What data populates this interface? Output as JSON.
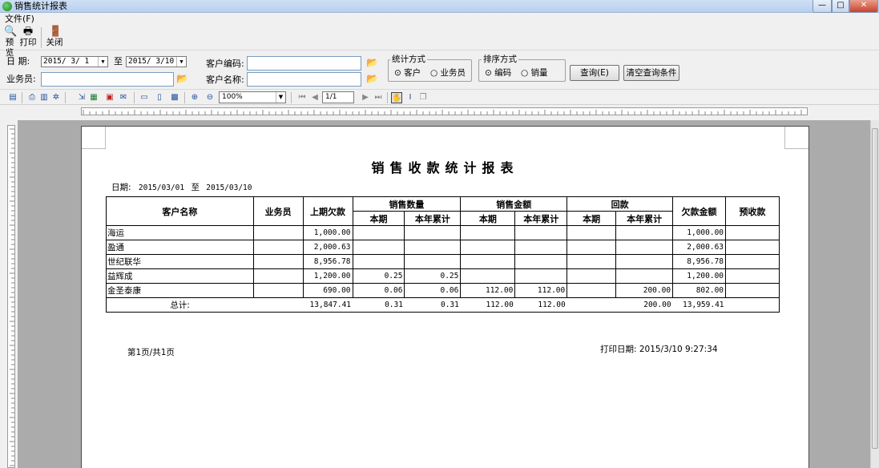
{
  "window": {
    "title": "销售统计报表",
    "controls": [
      "—",
      "□",
      "✕"
    ]
  },
  "menu": {
    "file": "文件(F)"
  },
  "toolbar": {
    "preview": "预览",
    "print": "打印",
    "close": "关闭"
  },
  "filters": {
    "date_label": "日 期:",
    "date_from": "2015/ 3/ 1",
    "to_label": "至",
    "date_to": "2015/ 3/10",
    "salesman_label": "业务员:",
    "salesman_value": "",
    "customer_code_label": "客户编码:",
    "customer_code_value": "",
    "customer_name_label": "客户名称:",
    "customer_name_value": "",
    "stat_group_title": "统计方式",
    "stat_options": [
      "客户",
      "业务员"
    ],
    "stat_selected": "客户",
    "sort_group_title": "排序方式",
    "sort_options": [
      "编码",
      "销量"
    ],
    "sort_selected": "编码",
    "query_button": "查询(E)",
    "clear_button": "清空查询条件"
  },
  "preview_toolbar": {
    "zoom": "100%",
    "page": "1/1"
  },
  "report": {
    "title": "销售收款统计报表",
    "date_line_label": "日期:",
    "date_from": "2015/03/01",
    "date_to_label": "至",
    "date_to": "2015/03/10",
    "headers": {
      "customer": "客户名称",
      "salesman": "业务员",
      "prev_debt": "上期欠款",
      "sales_qty": "销售数量",
      "sales_amt": "销售金额",
      "payment": "回款",
      "current": "本期",
      "ytd": "本年累计",
      "debt": "欠款金额",
      "prepaid": "预收款"
    },
    "rows": [
      {
        "customer": "海运",
        "salesman": "",
        "prev": "1,000.00",
        "qty_cur": "",
        "qty_ytd": "",
        "amt_cur": "",
        "amt_ytd": "",
        "pay_cur": "",
        "pay_ytd": "",
        "debt": "1,000.00",
        "prepaid": ""
      },
      {
        "customer": "盈通",
        "salesman": "",
        "prev": "2,000.63",
        "qty_cur": "",
        "qty_ytd": "",
        "amt_cur": "",
        "amt_ytd": "",
        "pay_cur": "",
        "pay_ytd": "",
        "debt": "2,000.63",
        "prepaid": ""
      },
      {
        "customer": "世纪联华",
        "salesman": "",
        "prev": "8,956.78",
        "qty_cur": "",
        "qty_ytd": "",
        "amt_cur": "",
        "amt_ytd": "",
        "pay_cur": "",
        "pay_ytd": "",
        "debt": "8,956.78",
        "prepaid": ""
      },
      {
        "customer": "益辉成",
        "salesman": "",
        "prev": "1,200.00",
        "qty_cur": "0.25",
        "qty_ytd": "0.25",
        "amt_cur": "",
        "amt_ytd": "",
        "pay_cur": "",
        "pay_ytd": "",
        "debt": "1,200.00",
        "prepaid": ""
      },
      {
        "customer": "金圣泰康",
        "salesman": "",
        "prev": "690.00",
        "qty_cur": "0.06",
        "qty_ytd": "0.06",
        "amt_cur": "112.00",
        "amt_ytd": "112.00",
        "pay_cur": "",
        "pay_ytd": "200.00",
        "debt": "802.00",
        "prepaid": ""
      }
    ],
    "total": {
      "label": "总计:",
      "prev": "13,847.41",
      "qty_cur": "0.31",
      "qty_ytd": "0.31",
      "amt_cur": "112.00",
      "amt_ytd": "112.00",
      "pay_cur": "",
      "pay_ytd": "200.00",
      "debt": "13,959.41",
      "prepaid": ""
    },
    "page_info": "第1页/共1页",
    "print_date": "打印日期: 2015/3/10 9:27:34"
  }
}
